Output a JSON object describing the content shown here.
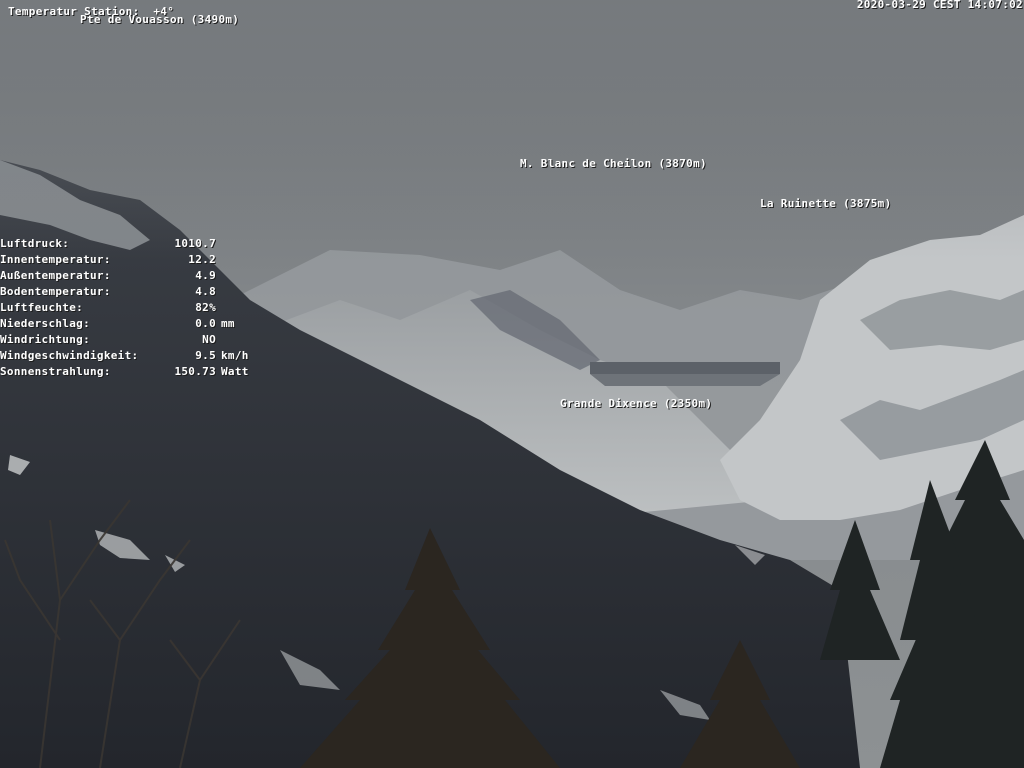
{
  "overlay": {
    "station_line": "Temperatur Station:  +4°",
    "peak_left": "Pte de Vouasson (3490m)",
    "timestamp": "2020-03-29 CEST 14:07:02"
  },
  "labels": {
    "blanc_de_cheilon": "M. Blanc de Cheilon (3870m)",
    "la_ruinette": "La Ruinette (3875m)",
    "grande_dixence": "Grande Dixence (2350m)"
  },
  "weather": [
    {
      "label": "Luftdruck:",
      "value": "1010.7",
      "unit": ""
    },
    {
      "label": "Innentemperatur:",
      "value": "12.2",
      "unit": ""
    },
    {
      "label": "Außentemperatur:",
      "value": "4.9",
      "unit": ""
    },
    {
      "label": "Bodentemperatur:",
      "value": "4.8",
      "unit": ""
    },
    {
      "label": "Luftfeuchte:",
      "value": "82%",
      "unit": ""
    },
    {
      "label": "Niederschlag:",
      "value": "0.0",
      "unit": "mm"
    },
    {
      "label": "Windrichtung:",
      "value": "NO",
      "unit": ""
    },
    {
      "label": "Windgeschwindigkeit:",
      "value": "9.5",
      "unit": "km/h"
    },
    {
      "label": "Sonnenstrahlung:",
      "value": "150.73",
      "unit": "Watt"
    }
  ]
}
